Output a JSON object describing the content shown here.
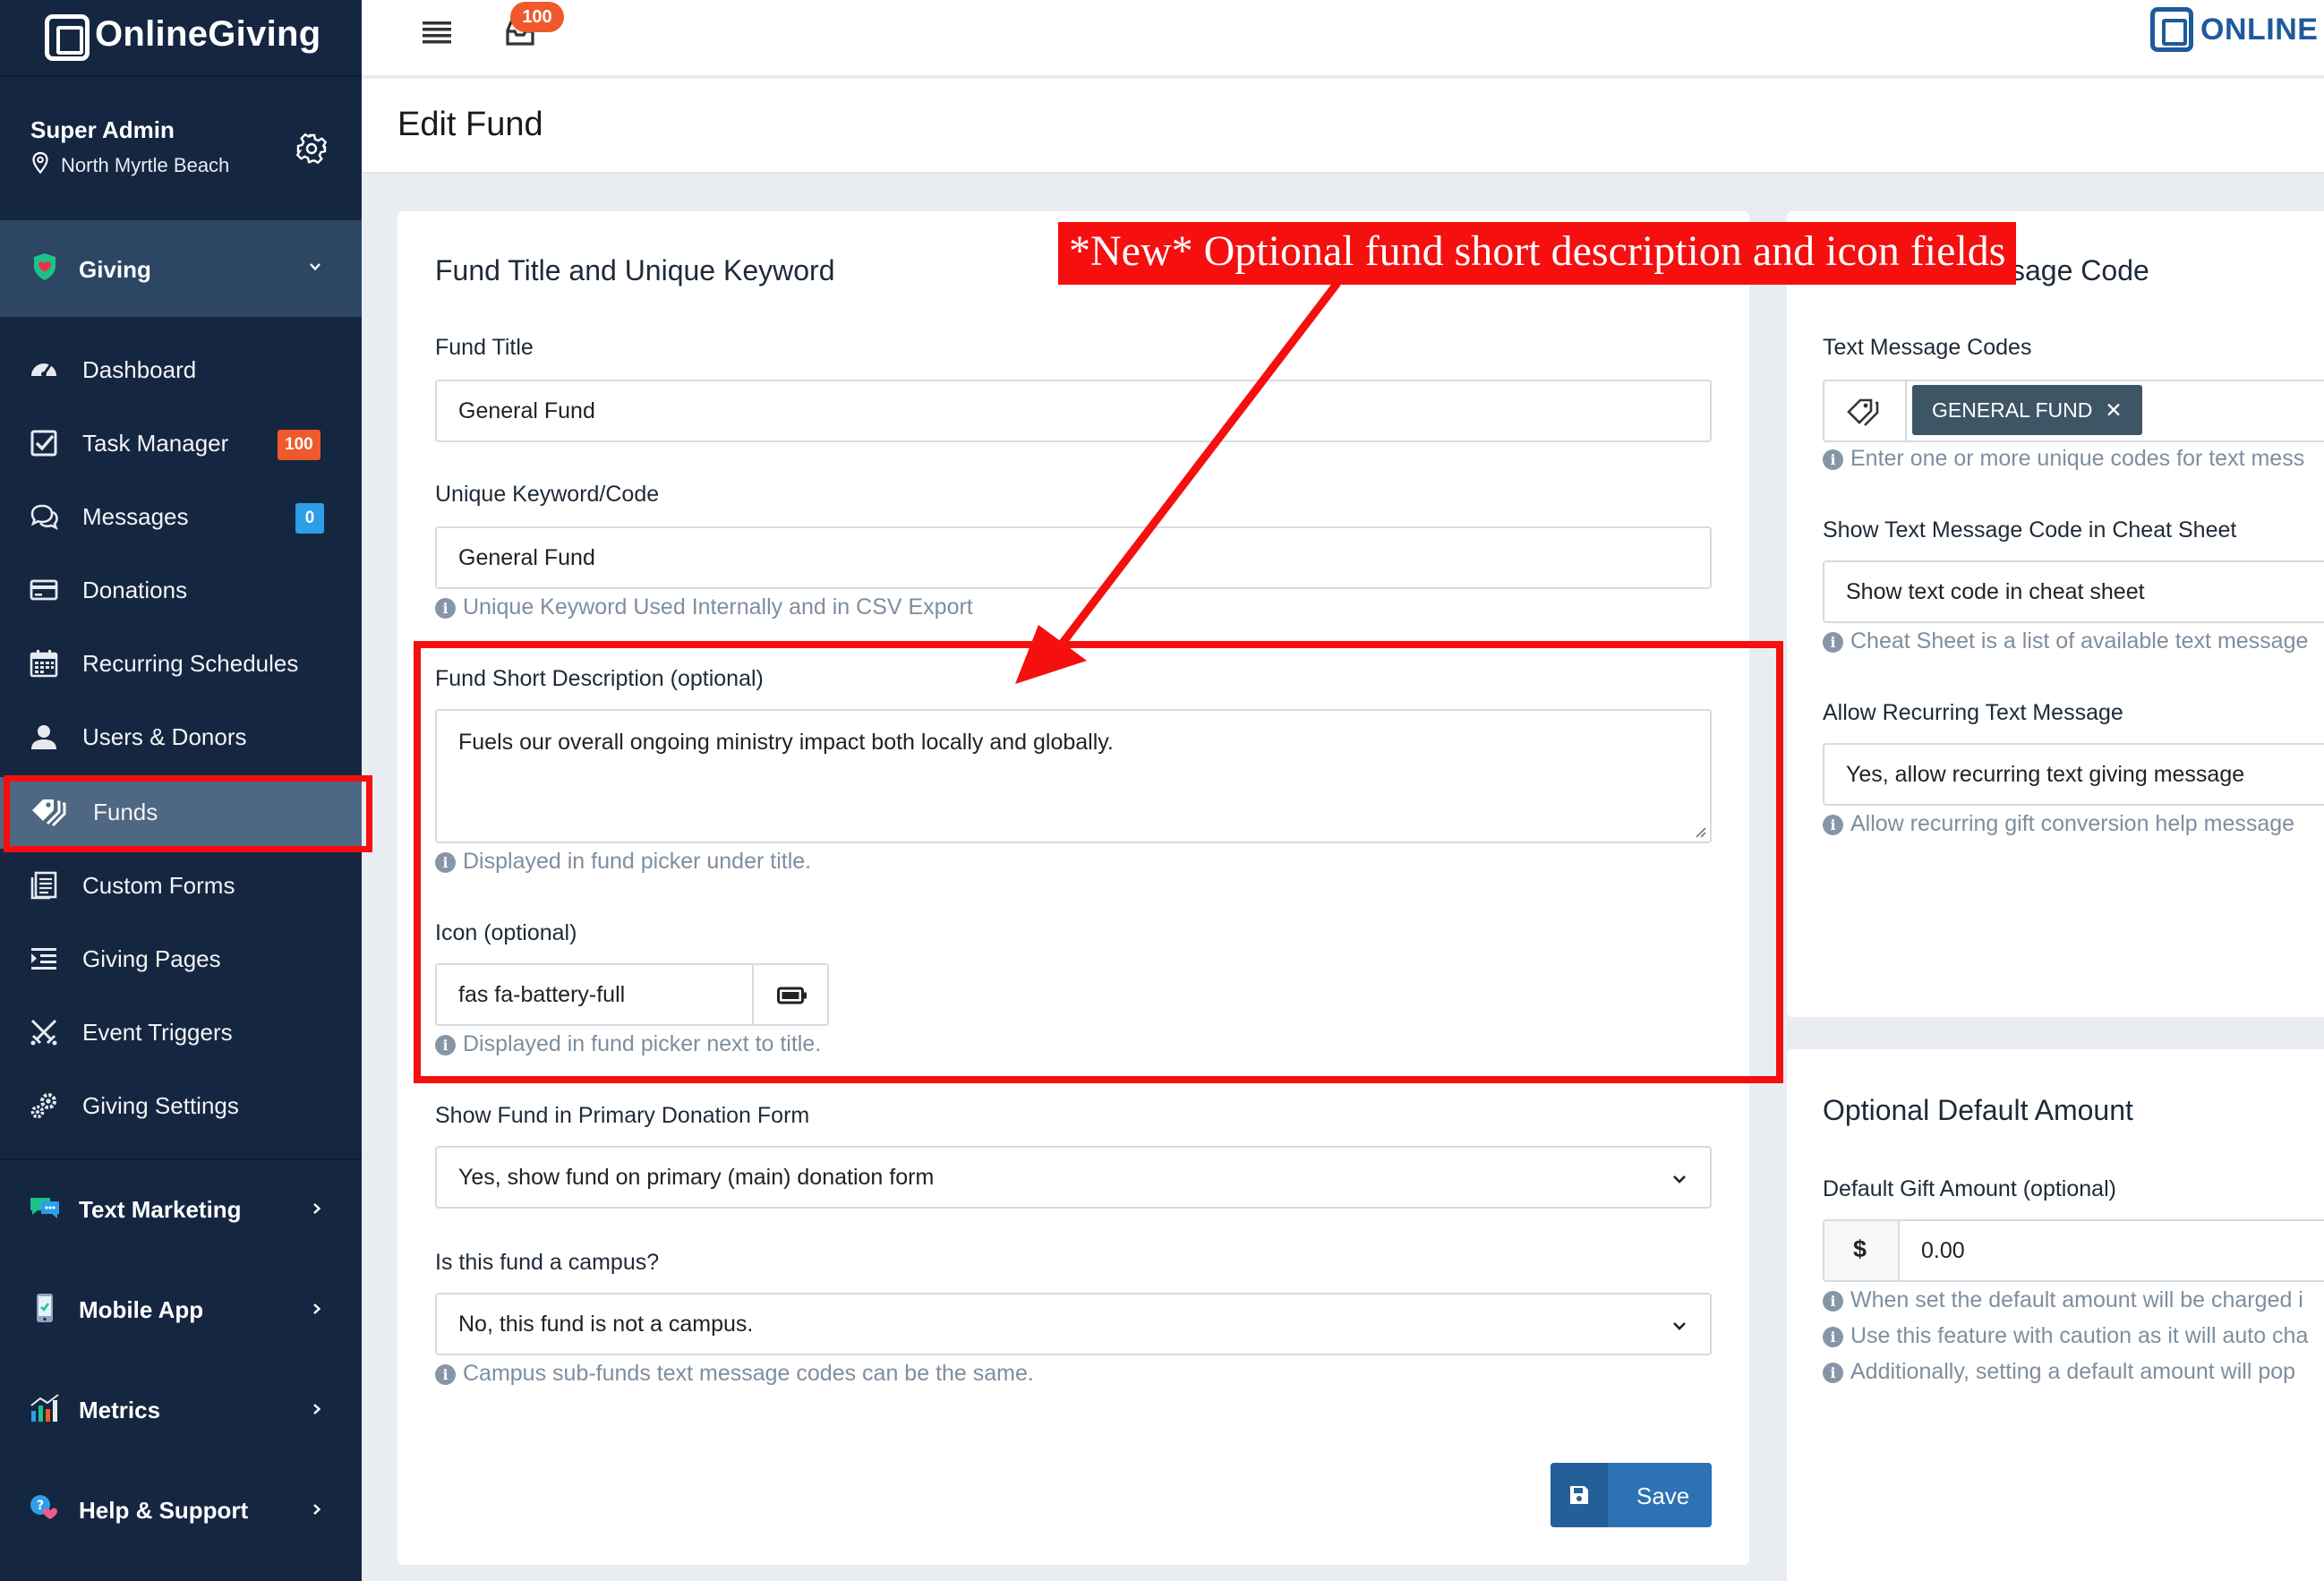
{
  "brand": {
    "name": "OnlineGiving"
  },
  "user": {
    "name": "Super Admin",
    "location": "North Myrtle Beach"
  },
  "sidebar": {
    "section": {
      "label": "Giving"
    },
    "items": [
      {
        "label": "Dashboard",
        "icon": "dashboard-gauge-icon"
      },
      {
        "label": "Task Manager",
        "icon": "checkbox-icon",
        "badge": "100",
        "badge_color": "#f0592b"
      },
      {
        "label": "Messages",
        "icon": "chat-icon",
        "badge": "0",
        "badge_color": "#2d9ee8"
      },
      {
        "label": "Donations",
        "icon": "credit-card-icon"
      },
      {
        "label": "Recurring Schedules",
        "icon": "calendar-icon"
      },
      {
        "label": "Users & Donors",
        "icon": "user-icon"
      },
      {
        "label": "Funds",
        "icon": "tags-icon",
        "active": true
      },
      {
        "label": "Custom Forms",
        "icon": "forms-icon"
      },
      {
        "label": "Giving Pages",
        "icon": "list-indent-icon"
      },
      {
        "label": "Event Triggers",
        "icon": "crossed-swords-icon"
      },
      {
        "label": "Giving Settings",
        "icon": "gears-icon"
      }
    ],
    "groups": [
      {
        "label": "Text Marketing",
        "icon": "sms-chat-icon"
      },
      {
        "label": "Mobile App",
        "icon": "mobile-phone-icon"
      },
      {
        "label": "Metrics",
        "icon": "bar-chart-icon"
      },
      {
        "label": "Help & Support",
        "icon": "help-chat-icon"
      }
    ]
  },
  "topbar": {
    "notification_count": "100",
    "logo_text": "ONLINE"
  },
  "page": {
    "title": "Edit Fund"
  },
  "main_form": {
    "card_title": "Fund Title and Unique Keyword",
    "fund_title": {
      "label": "Fund Title",
      "value": "General Fund"
    },
    "keyword": {
      "label": "Unique Keyword/Code",
      "value": "General Fund",
      "help": "Unique Keyword Used Internally and in CSV Export"
    },
    "short_description": {
      "label": "Fund Short Description (optional)",
      "value": "Fuels our overall ongoing ministry impact both locally and globally.",
      "help": "Displayed in fund picker under title."
    },
    "icon": {
      "label": "Icon (optional)",
      "value": "fas fa-battery-full",
      "help": "Displayed in fund picker next to title."
    },
    "show_primary": {
      "label": "Show Fund in Primary Donation Form",
      "value": "Yes, show fund on primary (main) donation form"
    },
    "campus": {
      "label": "Is this fund a campus?",
      "value": "No, this fund is not a campus.",
      "help": "Campus sub-funds text message codes can be the same."
    },
    "save_label": "Save"
  },
  "annotation": {
    "text": "*New* Optional fund short description and icon fields"
  },
  "text_codes": {
    "card_title_visible": "sage Code",
    "codes": {
      "label": "Text Message Codes",
      "tag": "GENERAL FUND",
      "help": "Enter one or more unique codes for text mess"
    },
    "cheat_sheet": {
      "label": "Show Text Message Code in Cheat Sheet",
      "value": "Show text code in cheat sheet",
      "help": "Cheat Sheet is a list of available text message"
    },
    "recurring": {
      "label": "Allow Recurring Text Message",
      "value": "Yes, allow recurring text giving message",
      "help": "Allow recurring gift conversion help message"
    }
  },
  "default_amount": {
    "card_title": "Optional Default Amount",
    "label": "Default Gift Amount (optional)",
    "currency": "$",
    "value": "0.00",
    "help": [
      "When set the default amount will be charged i",
      "Use this feature with caution as it will auto cha",
      "Additionally, setting a default amount will pop"
    ]
  },
  "colors": {
    "sidebar_bg": "#152641",
    "accent_blue": "#2c72b5",
    "annotation_red": "#f50f0f",
    "badge_orange": "#f0592b",
    "badge_blue": "#2d9ee8"
  }
}
